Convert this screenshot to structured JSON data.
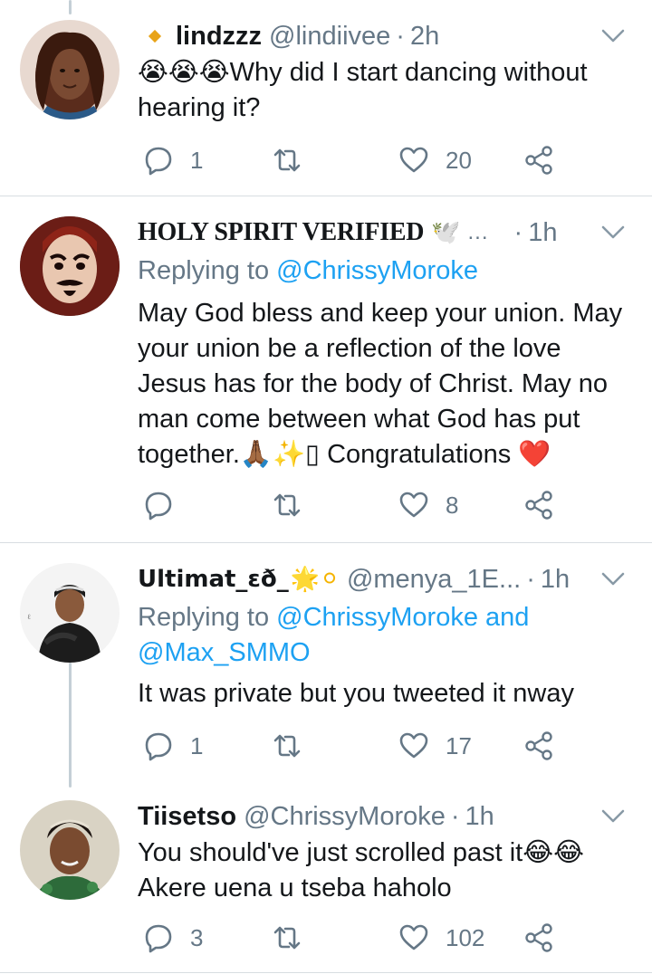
{
  "tweets": [
    {
      "name": "lindzzz",
      "handle": "@lindiivee",
      "dot": "·",
      "time": "2h",
      "text_emoji": "😭😭😭",
      "text": "Why did I start dancing without hearing it?",
      "reply_count": "1",
      "like_count": "20"
    },
    {
      "name": "HOLY SPIRIT VERIFIED",
      "name_emoji": "🕊️",
      "ellipsis": "...",
      "dot": "·",
      "time": "1h",
      "replying_prefix": "Replying to",
      "replying_to": "@ChrissyMoroke",
      "text": "May God bless and keep your union. May your union be a reflection of the love Jesus has for the body of Christ. May no man come between what God has put together.🙏🏾✨▯ Congratulations ❤️",
      "reply_count": "",
      "like_count": "8"
    },
    {
      "name": "Ultimat_ɛð_",
      "name_emoji": "🌟⚪",
      "handle": "@menya_1E...",
      "dot": "·",
      "time": "1h",
      "replying_prefix": "Replying to",
      "replying_to": "@ChrissyMoroke and @Max_SMMO",
      "text": "It was private but you tweeted it nway",
      "reply_count": "1",
      "like_count": "17"
    },
    {
      "name": "Tiisetso",
      "handle": "@ChrissyMoroke",
      "dot": "·",
      "time": "1h",
      "text": "You should've just scrolled past it",
      "text_emoji": "😂😂",
      "text_line2": "Akere uena u tseba haholo",
      "reply_count": "3",
      "like_count": "102"
    }
  ],
  "icons": [
    "reply-icon",
    "retweet-icon",
    "like-icon",
    "share-icon",
    "chevron-down-icon"
  ],
  "colors": {
    "accent": "#1da1f2",
    "muted": "#657786",
    "text": "#14171a",
    "divider": "#d8dde1",
    "badge": "#e8a317",
    "heart": "#e0245e"
  }
}
